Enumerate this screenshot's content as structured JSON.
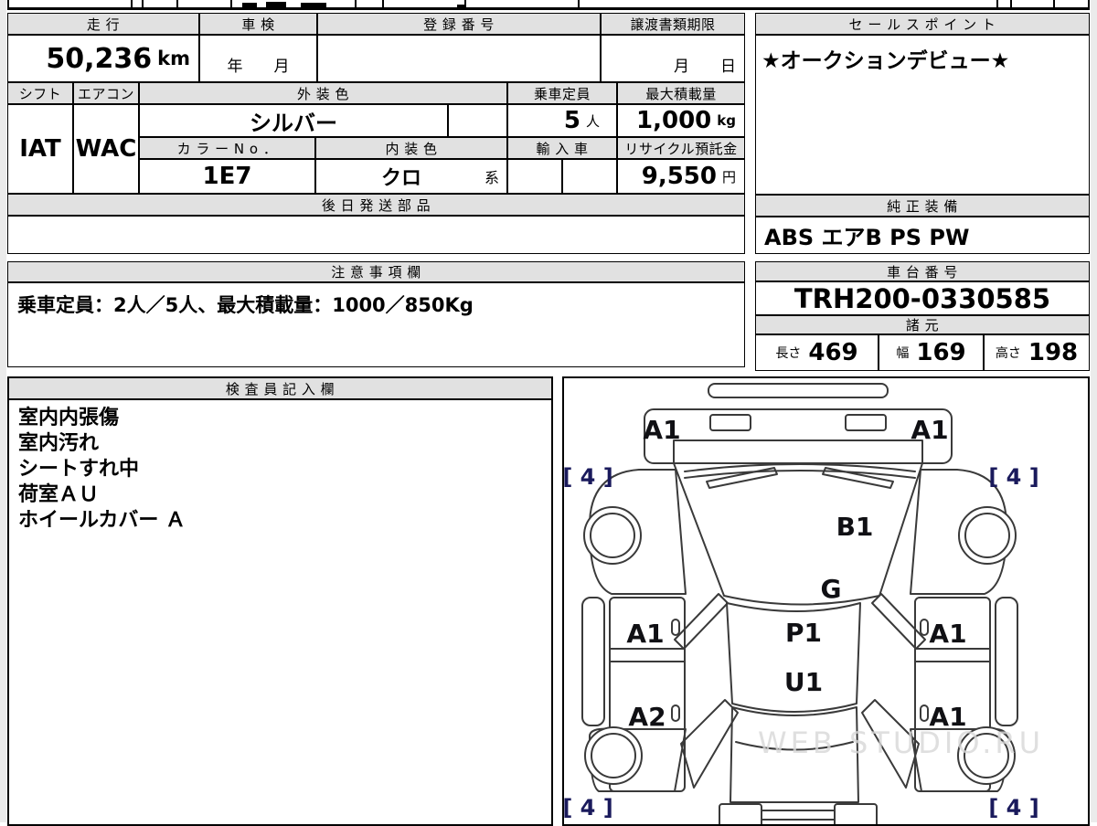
{
  "colors": {
    "header_bg": "#e1e1e1",
    "line": "#000000",
    "watermark": "#d8d8d8",
    "tread_label": "#1a1a5c"
  },
  "main_table": {
    "mileage_header": "走 行",
    "mileage_value": "50,236",
    "mileage_unit": "km",
    "inspection_header": "車 検",
    "inspection_value": "年　　月",
    "registration_header": "登 録 番 号",
    "registration_value": "",
    "transfer_deadline_header": "譲渡書類期限",
    "transfer_deadline_value": "月　　日",
    "shift_header": "シフト",
    "shift_value": "IAT",
    "aircon_header": "エアコン",
    "aircon_value": "WAC",
    "exterior_color_header": "外 装 色",
    "exterior_color_value": "シルバー",
    "capacity_header": "乗車定員",
    "capacity_value": "5",
    "capacity_unit": "人",
    "max_load_header": "最大積載量",
    "max_load_value": "1,000",
    "max_load_unit": "kg",
    "color_no_header": "カ ラ ー N o ．",
    "color_no_value": "1E7",
    "interior_color_header": "内 装 色",
    "interior_color_value": "クロ",
    "interior_color_suffix": "系",
    "import_header": "輸 入 車",
    "recycle_deposit_header": "リサイクル預託金",
    "recycle_deposit_value": "9,550",
    "recycle_deposit_unit": "円",
    "later_parts_header": "後 日 発 送 部 品"
  },
  "sales_point": {
    "header": "セ ー ル ス ポ イ ン ト",
    "value": "★オークションデビュー★"
  },
  "equipment": {
    "header": "純 正 装 備",
    "value": "ABS エアB PS PW"
  },
  "notes": {
    "header": "注 意 事 項 欄",
    "value": "乗車定員：2人／5人、最大積載量：1000／850Kg"
  },
  "chassis_no": {
    "header": "車 台 番 号",
    "value": "TRH200-0330585"
  },
  "dimensions": {
    "header": "諸 元",
    "length_label": "長さ",
    "length_value": "469",
    "width_label": "幅",
    "width_value": "169",
    "height_label": "高さ",
    "height_value": "198"
  },
  "inspector_notes": {
    "header": "検 査 員 記 入 欄",
    "items": [
      "室内内張傷",
      "室内汚れ",
      "シートすれ中",
      "荷室ＡＵ",
      "ホイールカバー Ａ"
    ]
  },
  "diagram": {
    "front_left": "A1",
    "front_right": "A1",
    "windshield": "B1",
    "glass": "G",
    "roof_front": "P1",
    "roof_rear": "U1",
    "door_front_left": "A1",
    "door_front_right": "A1",
    "door_rear_left": "A2",
    "door_rear_right": "A1",
    "tread_depth": "[ 4 ]",
    "watermark": "WEB STUDIO.RU"
  }
}
